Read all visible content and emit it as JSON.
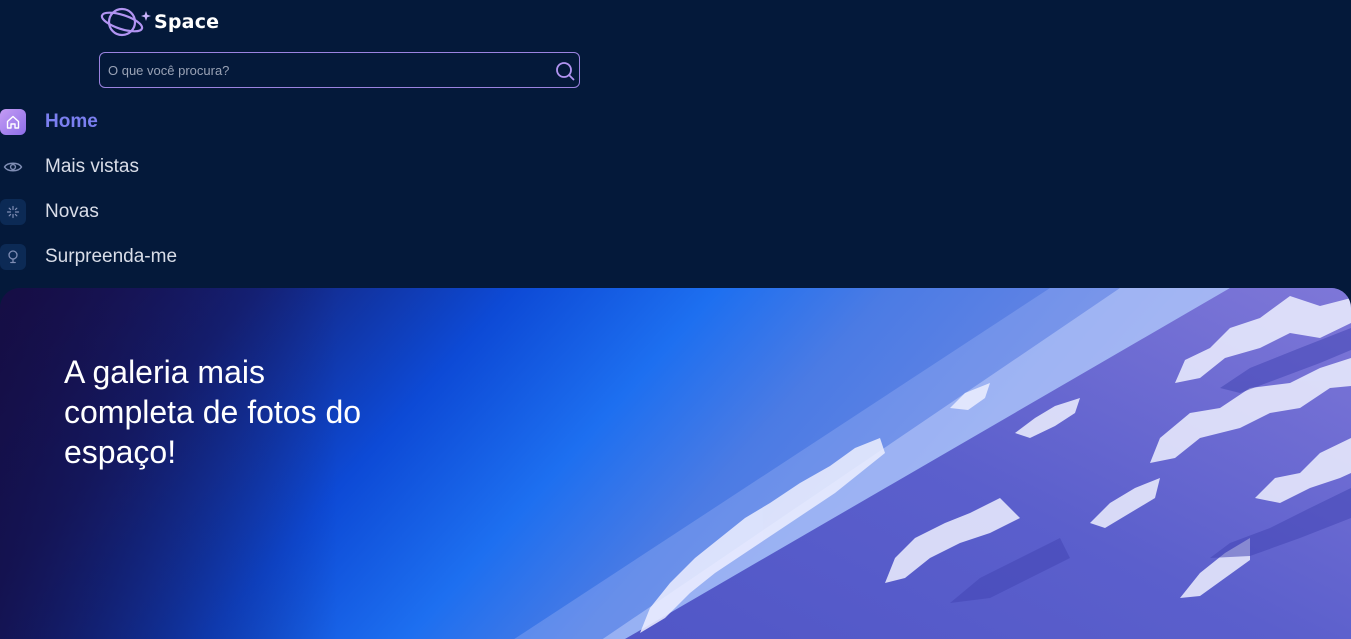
{
  "header": {
    "logo_text": "Space",
    "search": {
      "placeholder": "O que você procura?",
      "value": ""
    }
  },
  "nav": {
    "items": [
      {
        "label": "Home",
        "icon": "home-icon",
        "active": true
      },
      {
        "label": "Mais vistas",
        "icon": "eye-icon",
        "active": false
      },
      {
        "label": "Novas",
        "icon": "sparkle-icon",
        "active": false
      },
      {
        "label": "Surpreenda-me",
        "icon": "lightbulb-icon",
        "active": false
      }
    ]
  },
  "banner": {
    "title": "A galeria mais completa de fotos do espaço!",
    "image": "earth-from-space-mountains"
  },
  "colors": {
    "background": "#04193a",
    "accent": "#7b7ff0",
    "search_border": "#9b83e0",
    "active_icon": "#c49cf4",
    "text": "#d9dde8"
  }
}
